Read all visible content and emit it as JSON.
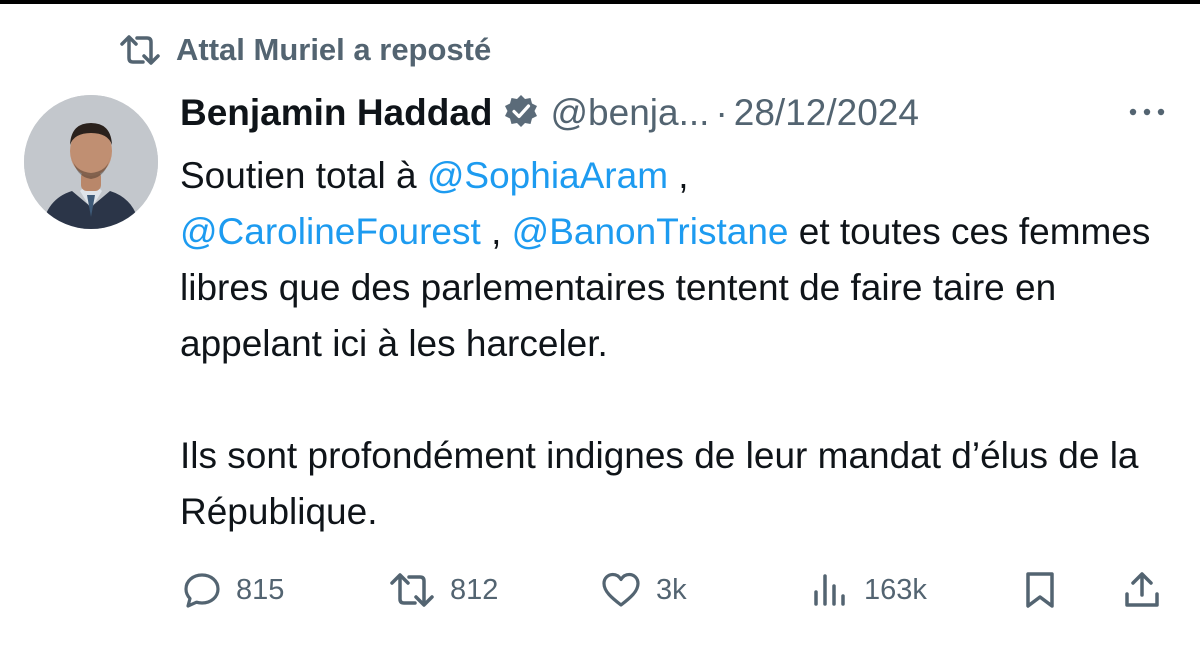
{
  "repost": {
    "icon": "repost-icon",
    "text": "Attal Muriel a reposté"
  },
  "author": {
    "name": "Benjamin Haddad",
    "verified_icon": "verified-badge-icon",
    "handle": "@benja...",
    "separator": "·",
    "date": "28/12/2024"
  },
  "tweet": {
    "p1": {
      "t1": "Soutien total à ",
      "m1": "@SophiaAram",
      "t2": " , ",
      "m2": "@CarolineFourest",
      "t3": " , ",
      "m3": "@BanonTristane",
      "t4": " et toutes ces femmes libres que des parlementaires tentent de faire taire en appelant ici à les harceler."
    },
    "p2": "Ils sont profondément indignes de leur mandat d’élus de la République."
  },
  "actions": {
    "replies": "815",
    "reposts": "812",
    "likes": "3k",
    "views": "163k"
  },
  "colors": {
    "mention": "#1d9bf0",
    "secondary_text": "#536471",
    "primary_text": "#0f1419",
    "verified_badge": "#5b6b79"
  }
}
